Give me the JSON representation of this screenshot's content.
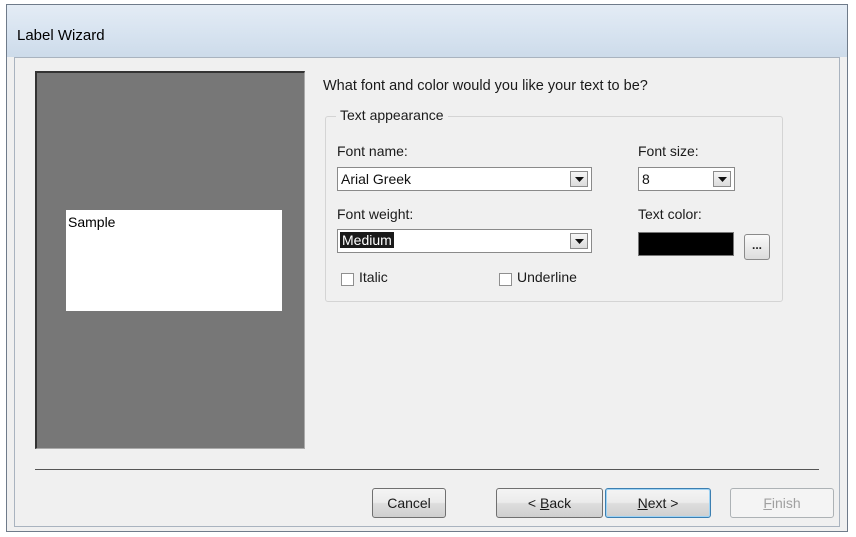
{
  "window": {
    "title": "Label Wizard"
  },
  "preview": {
    "sample_text": "Sample"
  },
  "question": "What font and color would you like your text to be?",
  "text_appearance": {
    "legend": "Text appearance",
    "font_name": {
      "label": "Font name:",
      "value": "Arial Greek"
    },
    "font_size": {
      "label": "Font size:",
      "value": "8"
    },
    "font_weight": {
      "label": "Font weight:",
      "value": "Medium"
    },
    "text_color": {
      "label": "Text color:",
      "value": "#000000",
      "browse_label": "..."
    },
    "italic": {
      "label": "Italic",
      "checked": false
    },
    "underline": {
      "label": "Underline",
      "checked": false
    }
  },
  "buttons": {
    "cancel": "Cancel",
    "back_prefix": "< ",
    "back_mnemonic": "B",
    "back_rest": "ack",
    "next_mnemonic": "N",
    "next_rest": "ext >",
    "finish_mnemonic": "F",
    "finish_rest": "inish"
  },
  "icons": {
    "dropdown": "chevron-down-icon",
    "checkbox": "checkbox-icon"
  },
  "colors": {
    "preview_background": "#777777",
    "swatch": "#000000",
    "default_button_border": "#3c7fb1"
  }
}
